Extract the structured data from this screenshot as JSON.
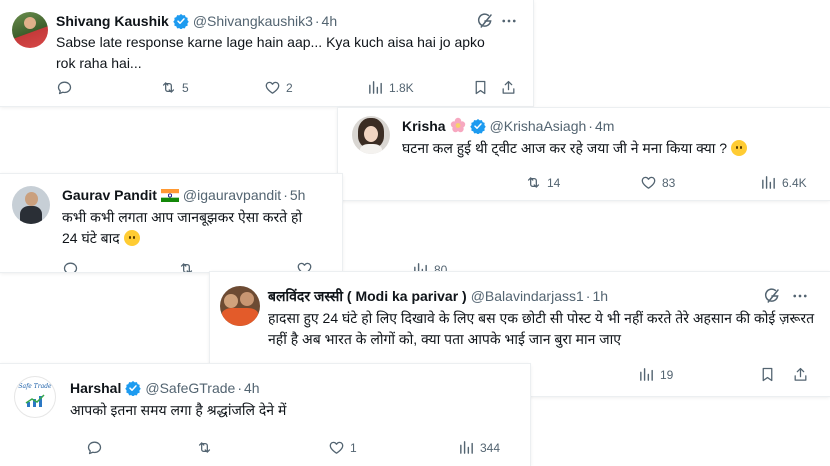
{
  "tweets": [
    {
      "name": "Shivang Kaushik",
      "handle": "@Shivangkaushik3",
      "time": "4h",
      "text": "Sabse late response karne lage hain aap... Kya kuch aisa hai jo apko rok raha hai...",
      "replies": "",
      "retweets": "5",
      "likes": "2",
      "views": "1.8K"
    },
    {
      "name": "Krisha",
      "handle": "@KrishaAsiagh",
      "time": "4m",
      "text": "घटना कल हुई थी ट्वीट आज कर रहे जया जी ने मना किया क्या ?",
      "retweets": "14",
      "likes": "83",
      "views": "6.4K"
    },
    {
      "name": "Gaurav Pandit",
      "handle": "@igauravpandit",
      "time": "5h",
      "text_line1": "कभी कभी लगता आप जानबूझकर ऐसा करते हो",
      "text_line2": "24 घंटे बाद",
      "views": "80"
    },
    {
      "name": "बलविंदर जस्सी ( Modi ka parivar )",
      "handle": "@Balavindarjass1",
      "time": "1h",
      "text": "हादसा हुए 24 घंटे हो लिए दिखावे के लिए बस एक छोटी सी पोस्ट ये भी नहीं करते तेरे अहसान की कोई ज़रूरत नहीं है अब भारत के लोगों को, क्या पता आपके भाई जान बुरा मान जाए",
      "views": "19"
    },
    {
      "name": "Harshal",
      "handle": "@SafeGTrade",
      "time": "4h",
      "text": "आपको इतना समय लगा है श्रद्धांजलि देने में",
      "likes": "1",
      "views": "344",
      "avatar_text": "Safe Trade"
    }
  ],
  "colors": {
    "verified": "#1d9bf0",
    "muted": "#536471",
    "text": "#0f1419"
  },
  "icons": [
    "verified-badge-icon",
    "grok-icon",
    "more-icon",
    "reply-icon",
    "retweet-icon",
    "like-icon",
    "views-icon",
    "bookmark-icon",
    "share-icon",
    "flower-emoji-icon",
    "india-flag-icon",
    "face-emoji-icon"
  ]
}
